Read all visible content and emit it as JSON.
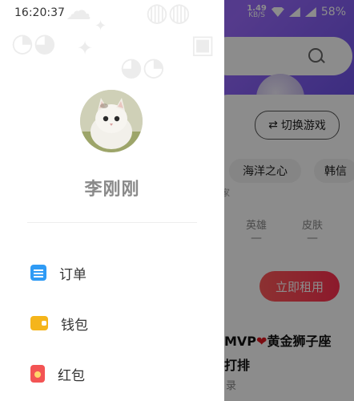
{
  "status_bar": {
    "time": "16:20:37",
    "net_speed_value": "1.49",
    "net_speed_unit": "KB/S",
    "battery": "58%"
  },
  "drawer": {
    "user_name": "李刚刚",
    "menu": [
      {
        "label": "订单",
        "icon": "order-icon"
      },
      {
        "label": "钱包",
        "icon": "wallet-icon"
      },
      {
        "label": "红包",
        "icon": "red-envelope-icon"
      }
    ]
  },
  "background": {
    "switch_game_label": "切换游戏",
    "chips": [
      "海洋之心",
      "韩信"
    ],
    "small_text": "家",
    "stats": [
      {
        "label": "英雄",
        "value": "—"
      },
      {
        "label": "皮肤",
        "value": "—"
      }
    ],
    "rent_button": "立即租用",
    "title_line1_prefix": "MVP",
    "title_line1_suffix": "黄金狮子座",
    "title_line2": "打排",
    "title_line3": "录"
  },
  "colors": {
    "header_purple": "#7b5cff",
    "rent_red": "#ff3a52",
    "drawer_bg": "#ffffff"
  }
}
